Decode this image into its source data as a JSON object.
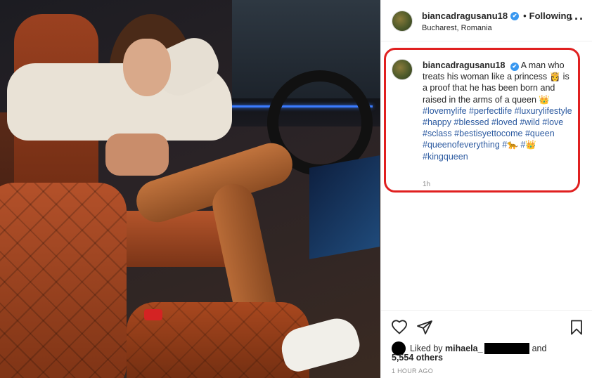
{
  "header": {
    "username": "biancadragusanu18",
    "verified_mark": "✔",
    "separator": "•",
    "follow_status": "Following",
    "location": "Bucharest, Romania",
    "more_glyph": "···"
  },
  "caption": {
    "username": "biancadragusanu18",
    "text": "A man who treats his woman like a princess 👸 is a proof that he has been born and raised in the arms of a queen 👑",
    "hashtags": [
      "#lovemylife",
      "#perfectlife",
      "#luxurylifestyle",
      "#happy",
      "#blessed",
      "#loved",
      "#wild",
      "#love",
      "#sclass",
      "#bestisyettocome",
      "#queen",
      "#queenofeverything",
      "#🐆",
      "#👑",
      "#kingqueen"
    ],
    "time": "1h"
  },
  "likes": {
    "liked_by_prefix": "Liked by",
    "liked_by_user": "mihaela_",
    "and": "and",
    "others_count": "5,554 others"
  },
  "timestamp": "1 HOUR AGO",
  "icons": {
    "like": "heart-outline-icon",
    "share": "paper-plane-icon",
    "save": "bookmark-icon",
    "more": "more-options-icon",
    "verified": "verified-badge-icon"
  },
  "colors": {
    "hashtag": "#2c5aa0",
    "verified": "#3897f0",
    "highlight": "#e02020",
    "muted": "#8e8e8e"
  }
}
